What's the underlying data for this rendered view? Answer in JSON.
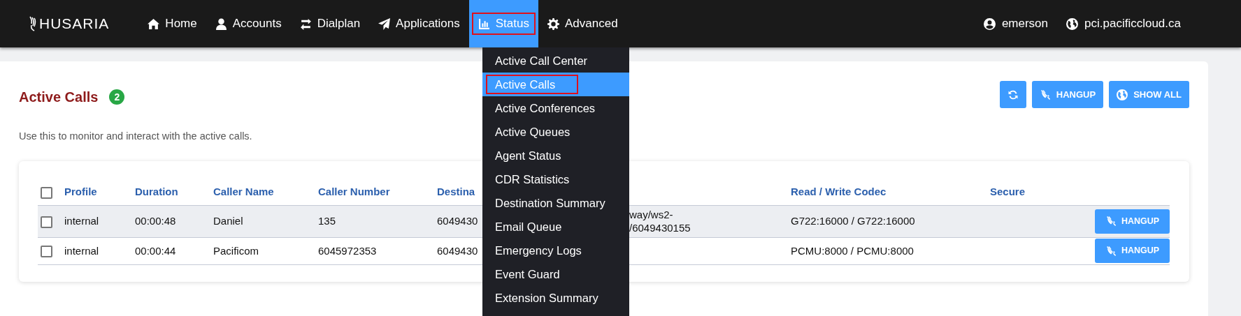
{
  "navbar": {
    "brand": "HUSARIA",
    "items": [
      {
        "label": "Home",
        "selected": false
      },
      {
        "label": "Accounts",
        "selected": false
      },
      {
        "label": "Dialplan",
        "selected": false
      },
      {
        "label": "Applications",
        "selected": false
      },
      {
        "label": "Status",
        "selected": true
      },
      {
        "label": "Advanced",
        "selected": false
      }
    ],
    "user": "emerson",
    "domain": "pci.pacificcloud.ca"
  },
  "dropdown": {
    "items": [
      {
        "label": "Active Call Center",
        "selected": false
      },
      {
        "label": "Active Calls",
        "selected": true
      },
      {
        "label": "Active Conferences",
        "selected": false
      },
      {
        "label": "Active Queues",
        "selected": false
      },
      {
        "label": "Agent Status",
        "selected": false
      },
      {
        "label": "CDR Statistics",
        "selected": false
      },
      {
        "label": "Destination Summary",
        "selected": false
      },
      {
        "label": "Email Queue",
        "selected": false
      },
      {
        "label": "Emergency Logs",
        "selected": false
      },
      {
        "label": "Event Guard",
        "selected": false
      },
      {
        "label": "Extension Summary",
        "selected": false
      }
    ]
  },
  "page": {
    "title": "Active Calls",
    "count": "2",
    "description": "Use this to monitor and interact with the active calls.",
    "actions": [
      {
        "kind": "refresh"
      },
      {
        "kind": "hangup",
        "label": "HANGUP"
      },
      {
        "kind": "globe",
        "label": "SHOW ALL"
      }
    ]
  },
  "table": {
    "select_all_checked": false,
    "columns": [
      "Profile",
      "Duration",
      "Caller Name",
      "Caller Number",
      "Destina",
      null,
      "Read / Write Codec",
      "Secure"
    ],
    "rows": [
      {
        "checked": false,
        "cells": [
          "internal",
          "00:00:48",
          "Daniel",
          "135",
          "6049430",
          "way/ws2-\n/6049430155",
          "G722:16000 / G722:16000",
          null
        ],
        "button": "HANGUP"
      },
      {
        "checked": false,
        "cells": [
          "internal",
          "00:00:44",
          "Pacificom",
          "6045972353",
          "6049430",
          null,
          "PCMU:8000 / PCMU:8000",
          null
        ],
        "button": "HANGUP"
      }
    ]
  }
}
